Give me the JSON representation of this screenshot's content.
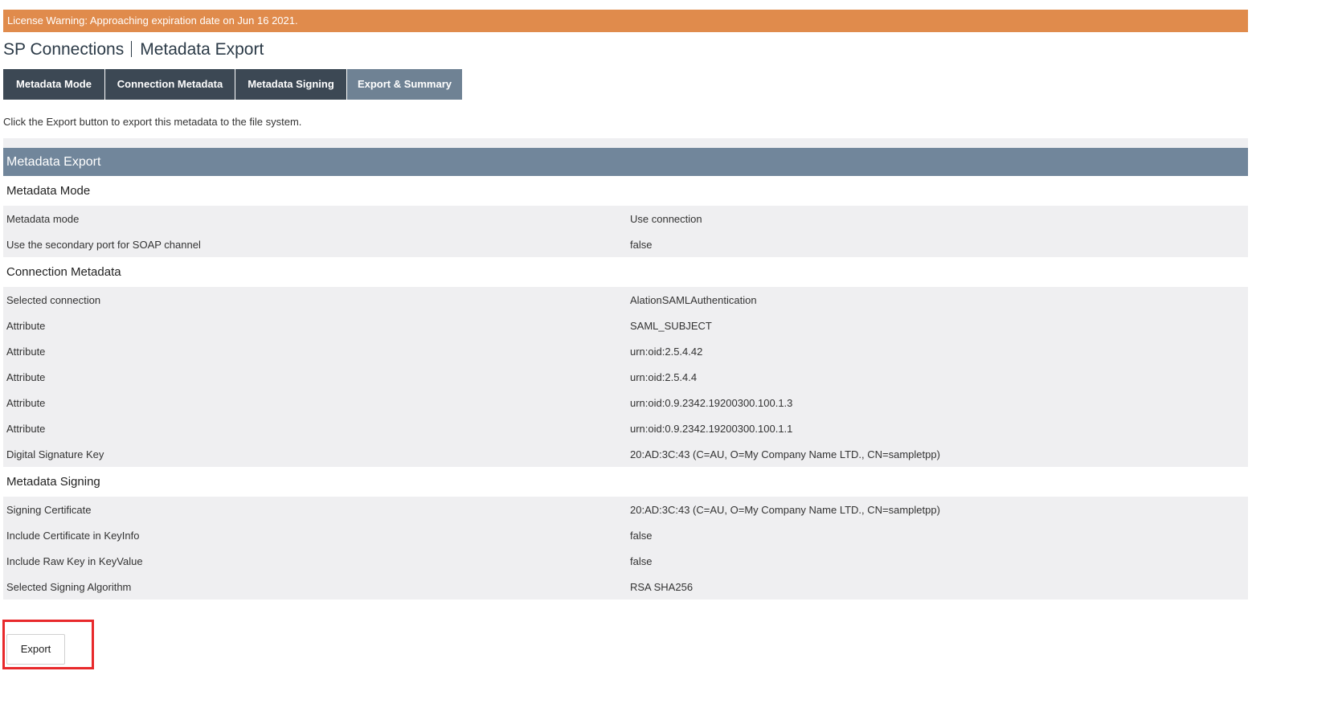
{
  "license_warning": "License Warning: Approaching expiration date on Jun 16 2021.",
  "breadcrumb": {
    "parent": "SP Connections",
    "current": "Metadata Export"
  },
  "tabs": [
    {
      "label": "Metadata Mode",
      "active": false
    },
    {
      "label": "Connection Metadata",
      "active": false
    },
    {
      "label": "Metadata Signing",
      "active": false
    },
    {
      "label": "Export & Summary",
      "active": true
    }
  ],
  "instructions": "Click the Export button to export this metadata to the file system.",
  "panel": {
    "title": "Metadata Export",
    "sections": [
      {
        "title": "Metadata Mode",
        "rows": [
          {
            "label": "Metadata mode",
            "value": "Use connection"
          },
          {
            "label": "Use the secondary port for SOAP channel",
            "value": "false"
          }
        ]
      },
      {
        "title": "Connection Metadata",
        "rows": [
          {
            "label": "Selected connection",
            "value": "AlationSAMLAuthentication"
          },
          {
            "label": "Attribute",
            "value": "SAML_SUBJECT"
          },
          {
            "label": "Attribute",
            "value": "urn:oid:2.5.4.42"
          },
          {
            "label": "Attribute",
            "value": "urn:oid:2.5.4.4"
          },
          {
            "label": "Attribute",
            "value": "urn:oid:0.9.2342.19200300.100.1.3"
          },
          {
            "label": "Attribute",
            "value": "urn:oid:0.9.2342.19200300.100.1.1"
          },
          {
            "label": "Digital Signature Key",
            "value": "20:AD:3C:43 (C=AU, O=My Company Name LTD., CN=sampletpp)"
          }
        ]
      },
      {
        "title": "Metadata Signing",
        "rows": [
          {
            "label": "Signing Certificate",
            "value": "20:AD:3C:43 (C=AU, O=My Company Name LTD., CN=sampletpp)"
          },
          {
            "label": "Include Certificate in KeyInfo",
            "value": "false"
          },
          {
            "label": "Include Raw Key in KeyValue",
            "value": "false"
          },
          {
            "label": "Selected Signing Algorithm",
            "value": "RSA SHA256"
          }
        ]
      }
    ]
  },
  "export_button": {
    "label": "Export"
  },
  "colors": {
    "license_banner": "#e08b4c",
    "tab_bg": "#3c4854",
    "tab_active_bg": "#6f8294",
    "panel_header_bg": "#71869b",
    "row_bg": "#efeff1",
    "highlight": "#e8292b"
  }
}
